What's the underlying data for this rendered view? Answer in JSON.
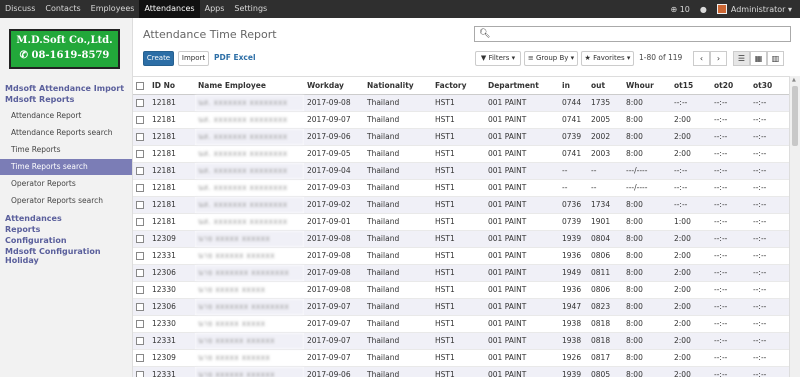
{
  "topbar": {
    "menu": [
      "Discuss",
      "Contacts",
      "Employees",
      "Attendances",
      "Apps",
      "Settings"
    ],
    "active": "Attendances",
    "notifications": "10",
    "user": "Administrator"
  },
  "logo": {
    "line1": "M.D.Soft Co.,Ltd.",
    "line2": "08-1619-8579"
  },
  "sidebar": {
    "section1": "Mdsoft Attendance Import",
    "section2": "Mdsoft Reports",
    "items": [
      "Attendance Report",
      "Attendance Reports search",
      "Time Reports",
      "Time Reports search",
      "Operator Reports",
      "Operator Reports search"
    ],
    "active_item": "Time Reports search",
    "section3": "Attendances",
    "section4": "Reports",
    "section5": "Configuration",
    "section6": "Mdsoft Configuration Holiday"
  },
  "control": {
    "title": "Attendance Time Report",
    "create": "Create",
    "import": "Import",
    "pdf_excel": "PDF Excel",
    "search_placeholder": "",
    "filters": "Filters",
    "group_by": "Group By",
    "favorites": "Favorites",
    "pager": "1-80 of 119"
  },
  "table": {
    "columns": [
      "ID No",
      "Name Employee",
      "Workday",
      "Nationality",
      "Factory",
      "Department",
      "in",
      "out",
      "Whour",
      "ot15",
      "ot20",
      "ot30"
    ],
    "rows": [
      [
        "12181",
        "นส. xxxxxxx xxxxxxxx",
        "2017-09-08",
        "Thailand",
        "HST1",
        "001 PAINT",
        "0744",
        "1735",
        "8:00",
        "--:--",
        "--:--",
        "--:--"
      ],
      [
        "12181",
        "นส. xxxxxxx xxxxxxxx",
        "2017-09-07",
        "Thailand",
        "HST1",
        "001 PAINT",
        "0741",
        "2005",
        "8:00",
        "2:00",
        "--:--",
        "--:--"
      ],
      [
        "12181",
        "นส. xxxxxxx xxxxxxxx",
        "2017-09-06",
        "Thailand",
        "HST1",
        "001 PAINT",
        "0739",
        "2002",
        "8:00",
        "2:00",
        "--:--",
        "--:--"
      ],
      [
        "12181",
        "นส. xxxxxxx xxxxxxxx",
        "2017-09-05",
        "Thailand",
        "HST1",
        "001 PAINT",
        "0741",
        "2003",
        "8:00",
        "2:00",
        "--:--",
        "--:--"
      ],
      [
        "12181",
        "นส. xxxxxxx xxxxxxxx",
        "2017-09-04",
        "Thailand",
        "HST1",
        "001 PAINT",
        "--",
        "--",
        "---/----",
        "--:--",
        "--:--",
        "--:--"
      ],
      [
        "12181",
        "นส. xxxxxxx xxxxxxxx",
        "2017-09-03",
        "Thailand",
        "HST1",
        "001 PAINT",
        "--",
        "--",
        "---/----",
        "--:--",
        "--:--",
        "--:--"
      ],
      [
        "12181",
        "นส. xxxxxxx xxxxxxxx",
        "2017-09-02",
        "Thailand",
        "HST1",
        "001 PAINT",
        "0736",
        "1734",
        "8:00",
        "--:--",
        "--:--",
        "--:--"
      ],
      [
        "12181",
        "นส. xxxxxxx xxxxxxxx",
        "2017-09-01",
        "Thailand",
        "HST1",
        "001 PAINT",
        "0739",
        "1901",
        "8:00",
        "1:00",
        "--:--",
        "--:--"
      ],
      [
        "12309",
        "นาย xxxxx xxxxxx",
        "2017-09-08",
        "Thailand",
        "HST1",
        "001 PAINT",
        "1939",
        "0804",
        "8:00",
        "2:00",
        "--:--",
        "--:--"
      ],
      [
        "12331",
        "นาย xxxxxx xxxxxx",
        "2017-09-08",
        "Thailand",
        "HST1",
        "001 PAINT",
        "1936",
        "0806",
        "8:00",
        "2:00",
        "--:--",
        "--:--"
      ],
      [
        "12306",
        "นาย xxxxxxx xxxxxxxx",
        "2017-09-08",
        "Thailand",
        "HST1",
        "001 PAINT",
        "1949",
        "0811",
        "8:00",
        "2:00",
        "--:--",
        "--:--"
      ],
      [
        "12330",
        "นาย xxxxx xxxxx",
        "2017-09-08",
        "Thailand",
        "HST1",
        "001 PAINT",
        "1936",
        "0806",
        "8:00",
        "2:00",
        "--:--",
        "--:--"
      ],
      [
        "12306",
        "นาย xxxxxxx xxxxxxxx",
        "2017-09-07",
        "Thailand",
        "HST1",
        "001 PAINT",
        "1947",
        "0823",
        "8:00",
        "2:00",
        "--:--",
        "--:--"
      ],
      [
        "12330",
        "นาย xxxxx xxxxx",
        "2017-09-07",
        "Thailand",
        "HST1",
        "001 PAINT",
        "1938",
        "0818",
        "8:00",
        "2:00",
        "--:--",
        "--:--"
      ],
      [
        "12331",
        "นาย xxxxxx xxxxxx",
        "2017-09-07",
        "Thailand",
        "HST1",
        "001 PAINT",
        "1938",
        "0818",
        "8:00",
        "2:00",
        "--:--",
        "--:--"
      ],
      [
        "12309",
        "นาย xxxxx xxxxxx",
        "2017-09-07",
        "Thailand",
        "HST1",
        "001 PAINT",
        "1926",
        "0817",
        "8:00",
        "2:00",
        "--:--",
        "--:--"
      ],
      [
        "12331",
        "นาย xxxxxx xxxxxx",
        "2017-09-06",
        "Thailand",
        "HST1",
        "001 PAINT",
        "1939",
        "0805",
        "8:00",
        "2:00",
        "--:--",
        "--:--"
      ]
    ]
  },
  "icons": {
    "notification": "clock-icon",
    "chat": "chat-icon",
    "search": "search-icon",
    "list_view": "list-icon",
    "grid_view": "grid-icon",
    "graph_view": "bar-chart-icon"
  },
  "colors": {
    "primary": "#2c6ea6",
    "sidebar_active": "#7b7db6",
    "logo_bg": "#22a83a"
  }
}
